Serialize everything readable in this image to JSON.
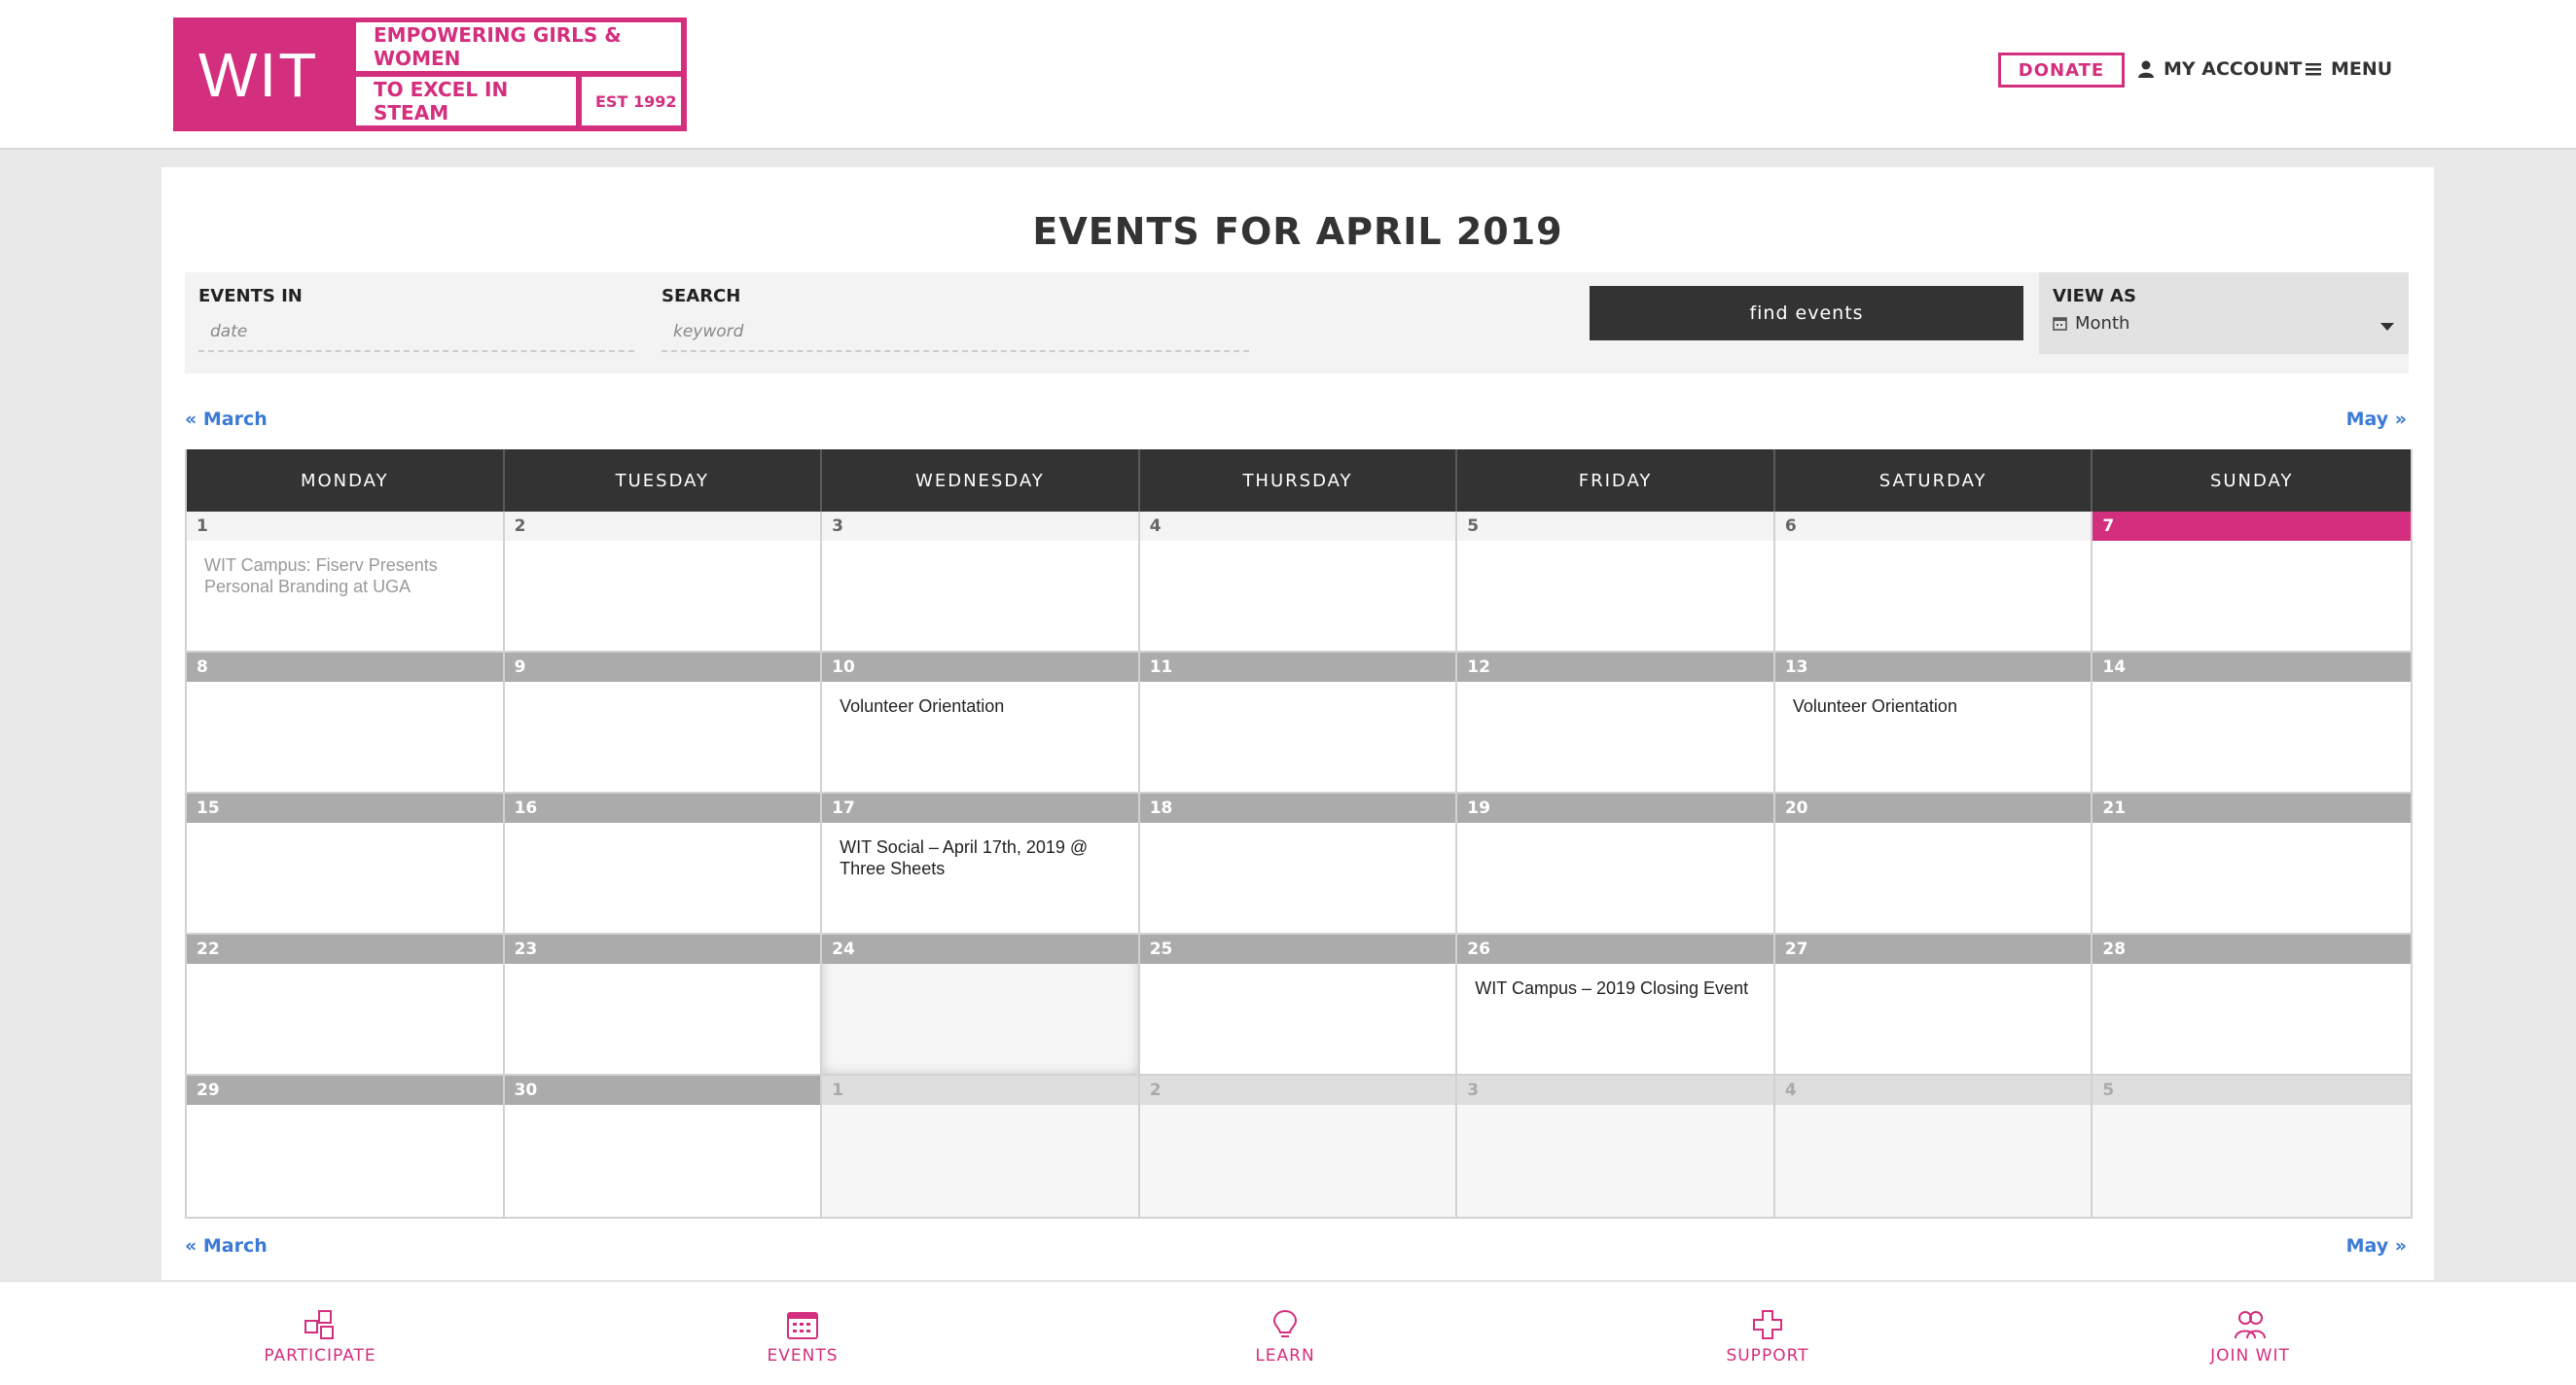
{
  "logo": {
    "wordmark": "WIT",
    "tagline_1": "EMPOWERING GIRLS & WOMEN",
    "tagline_2": "TO EXCEL IN STEAM",
    "established": "EST 1992"
  },
  "header": {
    "donate_label": "DONATE",
    "account_label": "MY ACCOUNT",
    "menu_label": "MENU"
  },
  "page": {
    "title": "EVENTS FOR APRIL 2019"
  },
  "filters": {
    "events_in_label": "EVENTS IN",
    "date_placeholder": "date",
    "search_label": "SEARCH",
    "keyword_placeholder": "keyword",
    "find_button": "find events",
    "view_as_label": "VIEW AS",
    "view_as_value": "Month"
  },
  "nav": {
    "prev": "« March",
    "next": "May »"
  },
  "calendar": {
    "weekdays": [
      "MONDAY",
      "TUESDAY",
      "WEDNESDAY",
      "THURSDAY",
      "FRIDAY",
      "SATURDAY",
      "SUNDAY"
    ],
    "weeks": [
      [
        {
          "day": "1",
          "event": "WIT Campus: Fiserv Presents Personal Branding at UGA"
        },
        {
          "day": "2",
          "event": ""
        },
        {
          "day": "3",
          "event": ""
        },
        {
          "day": "4",
          "event": ""
        },
        {
          "day": "5",
          "event": ""
        },
        {
          "day": "6",
          "event": ""
        },
        {
          "day": "7",
          "event": ""
        }
      ],
      [
        {
          "day": "8",
          "event": ""
        },
        {
          "day": "9",
          "event": ""
        },
        {
          "day": "10",
          "event": "Volunteer Orientation"
        },
        {
          "day": "11",
          "event": ""
        },
        {
          "day": "12",
          "event": ""
        },
        {
          "day": "13",
          "event": "Volunteer Orientation"
        },
        {
          "day": "14",
          "event": ""
        }
      ],
      [
        {
          "day": "15",
          "event": ""
        },
        {
          "day": "16",
          "event": ""
        },
        {
          "day": "17",
          "event": "WIT Social – April 17th, 2019 @ Three Sheets"
        },
        {
          "day": "18",
          "event": ""
        },
        {
          "day": "19",
          "event": ""
        },
        {
          "day": "20",
          "event": ""
        },
        {
          "day": "21",
          "event": ""
        }
      ],
      [
        {
          "day": "22",
          "event": ""
        },
        {
          "day": "23",
          "event": ""
        },
        {
          "day": "24",
          "event": ""
        },
        {
          "day": "25",
          "event": ""
        },
        {
          "day": "26",
          "event": "WIT Campus – 2019 Closing Event"
        },
        {
          "day": "27",
          "event": ""
        },
        {
          "day": "28",
          "event": ""
        }
      ],
      [
        {
          "day": "29",
          "event": ""
        },
        {
          "day": "30",
          "event": ""
        },
        {
          "day": "1",
          "event": ""
        },
        {
          "day": "2",
          "event": ""
        },
        {
          "day": "3",
          "event": ""
        },
        {
          "day": "4",
          "event": ""
        },
        {
          "day": "5",
          "event": ""
        }
      ]
    ]
  },
  "bottom_nav": {
    "participate": "PARTICIPATE",
    "events": "EVENTS",
    "learn": "LEARN",
    "support": "SUPPORT",
    "join": "JOIN WIT"
  },
  "colors": {
    "brand": "#d42e7e",
    "link": "#3b7bd6",
    "header_dark": "#333333"
  }
}
